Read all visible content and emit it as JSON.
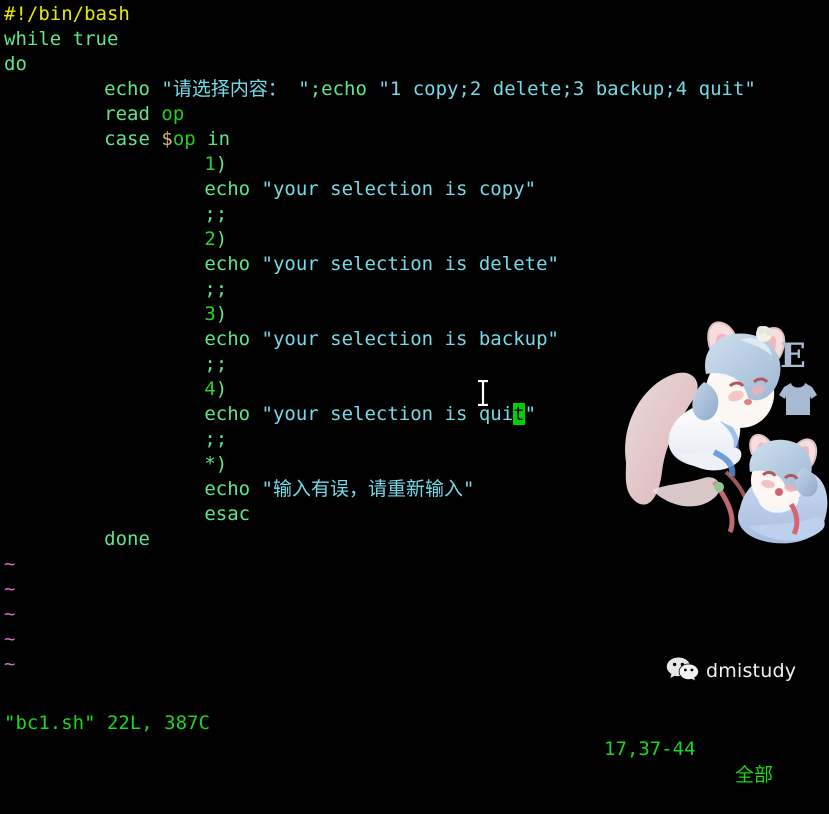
{
  "editor": {
    "app": "vim",
    "filename": "bc1.sh",
    "background_color": "#000000",
    "colors": {
      "shebang": "#e8e800",
      "keyword": "#5ee68a",
      "string": "#74dbe8",
      "number": "#27d427",
      "variable": "#22cc22",
      "tilde": "#d16ed1",
      "status": "#19d919",
      "cursor": "#00d000"
    }
  },
  "code_lines": [
    {
      "indent": 0,
      "tokens": [
        {
          "text": "#!/bin/bash",
          "cls": "t-shebang"
        }
      ]
    },
    {
      "indent": 0,
      "tokens": [
        {
          "text": "while",
          "cls": "t-keyword"
        },
        {
          "text": " ",
          "cls": "t-plain"
        },
        {
          "text": "true",
          "cls": "t-keyword"
        }
      ]
    },
    {
      "indent": 0,
      "tokens": [
        {
          "text": "do",
          "cls": "t-keyword"
        }
      ]
    },
    {
      "indent": 8,
      "tokens": [
        {
          "text": "echo",
          "cls": "t-builtin"
        },
        {
          "text": " ",
          "cls": "t-plain"
        },
        {
          "text": "\"请选择内容： \"",
          "cls": "t-string"
        },
        {
          "text": ";",
          "cls": "t-operator"
        },
        {
          "text": "echo",
          "cls": "t-builtin"
        },
        {
          "text": " ",
          "cls": "t-plain"
        },
        {
          "text": "\"1 copy;2 delete;3 backup;4 quit\"",
          "cls": "t-string"
        }
      ]
    },
    {
      "indent": 8,
      "tokens": [
        {
          "text": "read",
          "cls": "t-builtin"
        },
        {
          "text": " ",
          "cls": "t-plain"
        },
        {
          "text": "op",
          "cls": "t-var"
        }
      ]
    },
    {
      "indent": 8,
      "tokens": [
        {
          "text": "case",
          "cls": "t-keyword"
        },
        {
          "text": " ",
          "cls": "t-plain"
        },
        {
          "text": "$",
          "cls": "t-dollar"
        },
        {
          "text": "op",
          "cls": "t-var"
        },
        {
          "text": " ",
          "cls": "t-plain"
        },
        {
          "text": "in",
          "cls": "t-keyword"
        }
      ]
    },
    {
      "indent": 16,
      "tokens": [
        {
          "text": "1",
          "cls": "t-number"
        },
        {
          "text": ")",
          "cls": "t-operator"
        }
      ]
    },
    {
      "indent": 16,
      "tokens": [
        {
          "text": "echo",
          "cls": "t-builtin"
        },
        {
          "text": " ",
          "cls": "t-plain"
        },
        {
          "text": "\"your selection is copy\"",
          "cls": "t-string"
        }
      ]
    },
    {
      "indent": 16,
      "tokens": [
        {
          "text": ";;",
          "cls": "t-operator"
        }
      ]
    },
    {
      "indent": 16,
      "tokens": [
        {
          "text": "2",
          "cls": "t-number"
        },
        {
          "text": ")",
          "cls": "t-operator"
        }
      ]
    },
    {
      "indent": 16,
      "tokens": [
        {
          "text": "echo",
          "cls": "t-builtin"
        },
        {
          "text": " ",
          "cls": "t-plain"
        },
        {
          "text": "\"your selection is delete\"",
          "cls": "t-string"
        }
      ]
    },
    {
      "indent": 16,
      "tokens": [
        {
          "text": ";;",
          "cls": "t-operator"
        }
      ]
    },
    {
      "indent": 16,
      "tokens": [
        {
          "text": "3",
          "cls": "t-number"
        },
        {
          "text": ")",
          "cls": "t-operator"
        }
      ]
    },
    {
      "indent": 16,
      "tokens": [
        {
          "text": "echo",
          "cls": "t-builtin"
        },
        {
          "text": " ",
          "cls": "t-plain"
        },
        {
          "text": "\"your selection is backup\"",
          "cls": "t-string"
        }
      ]
    },
    {
      "indent": 16,
      "tokens": [
        {
          "text": ";;",
          "cls": "t-operator"
        }
      ]
    },
    {
      "indent": 16,
      "tokens": [
        {
          "text": "4",
          "cls": "t-number"
        },
        {
          "text": ")",
          "cls": "t-operator"
        }
      ]
    },
    {
      "indent": 16,
      "tokens": [
        {
          "text": "echo",
          "cls": "t-builtin"
        },
        {
          "text": " ",
          "cls": "t-plain"
        },
        {
          "text": "\"your selection is qui",
          "cls": "t-string"
        },
        {
          "text": "t",
          "cls": "cursor-block"
        },
        {
          "text": "\"",
          "cls": "t-string"
        }
      ]
    },
    {
      "indent": 16,
      "tokens": [
        {
          "text": ";;",
          "cls": "t-operator"
        }
      ]
    },
    {
      "indent": 16,
      "tokens": [
        {
          "text": "*",
          "cls": "t-operator"
        },
        {
          "text": ")",
          "cls": "t-operator"
        }
      ]
    },
    {
      "indent": 16,
      "tokens": [
        {
          "text": "echo",
          "cls": "t-builtin"
        },
        {
          "text": " ",
          "cls": "t-plain"
        },
        {
          "text": "\"输入有误，请重新输入\"",
          "cls": "t-string"
        }
      ]
    },
    {
      "indent": 16,
      "tokens": [
        {
          "text": "esac",
          "cls": "t-keyword"
        }
      ]
    },
    {
      "indent": 8,
      "tokens": [
        {
          "text": "done",
          "cls": "t-keyword"
        }
      ]
    }
  ],
  "empty_line_marker": "~",
  "empty_line_count": 5,
  "status": {
    "file_info": "\"bc1.sh\" 22L, 387C",
    "ruler": "17,37-44",
    "position_percent": "全部"
  },
  "watermarks": {
    "wechat_name": "dmistudy",
    "wechat_icon": "wechat-icon",
    "character_icon": "anime-character-watermark",
    "letter_badge": "E",
    "shirt_icon": "t-shirt-icon"
  }
}
